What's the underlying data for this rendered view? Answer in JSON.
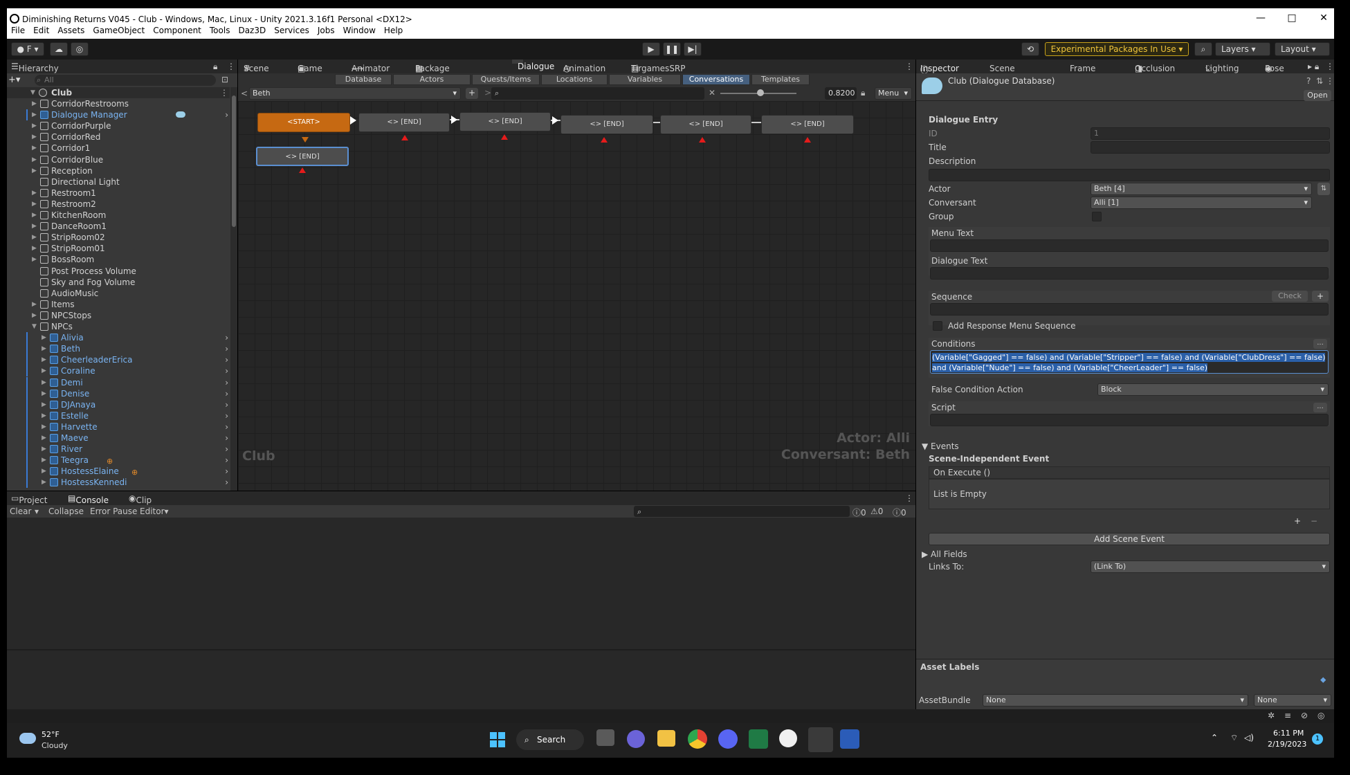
{
  "window": {
    "title": "Diminishing Returns V045 - Club - Windows, Mac, Linux - Unity 2021.3.16f1 Personal <DX12>"
  },
  "menu": [
    "File",
    "Edit",
    "Assets",
    "GameObject",
    "Component",
    "Tools",
    "Daz3D",
    "Services",
    "Jobs",
    "Window",
    "Help"
  ],
  "toolbar": {
    "account": "F",
    "packages": "Experimental Packages In Use",
    "layers": "Layers",
    "layout": "Layout"
  },
  "hierarchy": {
    "tab": "Hierarchy",
    "search_placeholder": "All",
    "root": "Club",
    "items": [
      {
        "label": "CorridorRestrooms",
        "blue": false,
        "expand": true
      },
      {
        "label": "Dialogue Manager",
        "blue": true,
        "expand": true
      },
      {
        "label": "CorridorPurple",
        "blue": false,
        "expand": true
      },
      {
        "label": "CorridorRed",
        "blue": false,
        "expand": true
      },
      {
        "label": "Corridor1",
        "blue": false,
        "expand": true
      },
      {
        "label": "CorridorBlue",
        "blue": false,
        "expand": true
      },
      {
        "label": "Reception",
        "blue": false,
        "expand": true
      },
      {
        "label": "Directional Light",
        "blue": false,
        "expand": false
      },
      {
        "label": "Restroom1",
        "blue": false,
        "expand": true
      },
      {
        "label": "Restroom2",
        "blue": false,
        "expand": true
      },
      {
        "label": "KitchenRoom",
        "blue": false,
        "expand": true
      },
      {
        "label": "DanceRoom1",
        "blue": false,
        "expand": true
      },
      {
        "label": "StripRoom02",
        "blue": false,
        "expand": true
      },
      {
        "label": "StripRoom01",
        "blue": false,
        "expand": true
      },
      {
        "label": "BossRoom",
        "blue": false,
        "expand": true
      },
      {
        "label": "Post Process Volume",
        "blue": false,
        "expand": false
      },
      {
        "label": "Sky and Fog Volume",
        "blue": false,
        "expand": false
      },
      {
        "label": "AudioMusic",
        "blue": false,
        "expand": false
      },
      {
        "label": "Items",
        "blue": false,
        "expand": true
      },
      {
        "label": "NPCStops",
        "blue": false,
        "expand": true
      },
      {
        "label": "NPCs",
        "blue": false,
        "expand": true
      }
    ],
    "npcs": [
      "Alivia",
      "Beth",
      "CheerleaderErica",
      "Coraline",
      "Demi",
      "Denise",
      "DJAnaya",
      "Estelle",
      "Harvette",
      "Maeve",
      "River",
      "Teegra",
      "HostessElaine",
      "HostessKennedi"
    ]
  },
  "center_tabs": [
    "Scene",
    "Game",
    "Animator",
    "Package Manager",
    "Dialogue",
    "Animation",
    "TirgamesSRP"
  ],
  "dialogue": {
    "subtabs": [
      "Database",
      "Actors",
      "Quests/Items",
      "Locations",
      "Variables",
      "Conversations",
      "Templates"
    ],
    "active_subtab": "Conversations",
    "conversation": "Beth",
    "zoom": "0.8200",
    "menu": "Menu",
    "start_node": "<START>",
    "end_node": "<> [END]",
    "watermark": "Club",
    "actor_label": "Actor: Alli",
    "conversant_label": "Conversant: Beth"
  },
  "console": {
    "tabs": [
      "Project",
      "Console",
      "Clip Editor"
    ],
    "buttons": [
      "Clear",
      "Collapse",
      "Error Pause",
      "Editor"
    ],
    "counts": [
      "0",
      "0",
      "0"
    ]
  },
  "inspector": {
    "tabs": [
      "Inspector",
      "Scene Optimizer",
      "Frame Debug",
      "Occlusion",
      "Lighting",
      "Pose E"
    ],
    "object": "Club (Dialogue Database)",
    "open": "Open",
    "section": "Dialogue Entry",
    "id_label": "ID",
    "id_value": "1",
    "title_label": "Title",
    "description_label": "Description",
    "actor_label": "Actor",
    "actor_value": "Beth [4]",
    "conversant_label": "Conversant",
    "conversant_value": "Alli [1]",
    "group_label": "Group",
    "menu_text_label": "Menu Text",
    "dialogue_text_label": "Dialogue Text",
    "sequence_label": "Sequence",
    "check": "Check",
    "add_response": "Add Response Menu Sequence",
    "conditions_label": "Conditions",
    "conditions_value": "(Variable[\"Gagged\"] == false) and (Variable[\"Stripper\"] == false) and (Variable[\"ClubDress\"] == false) and (Variable[\"Nude\"] == false) and (Variable[\"CheerLeader\"] == false)",
    "false_action_label": "False Condition Action",
    "false_action_value": "Block",
    "script_label": "Script",
    "events_label": "Events",
    "scene_event_label": "Scene-Independent Event",
    "on_execute": "On Execute ()",
    "list_empty": "List is Empty",
    "add_scene_event": "Add Scene Event",
    "all_fields": "All Fields",
    "links_to_label": "Links To:",
    "links_to_value": "(Link To)",
    "asset_labels": "Asset Labels",
    "assetbundle_label": "AssetBundle",
    "assetbundle_value": "None",
    "assetbundle_variant": "None"
  },
  "taskbar": {
    "temp": "52°F",
    "weather": "Cloudy",
    "search": "Search",
    "time": "6:11 PM",
    "date": "2/19/2023",
    "notify": "1"
  }
}
